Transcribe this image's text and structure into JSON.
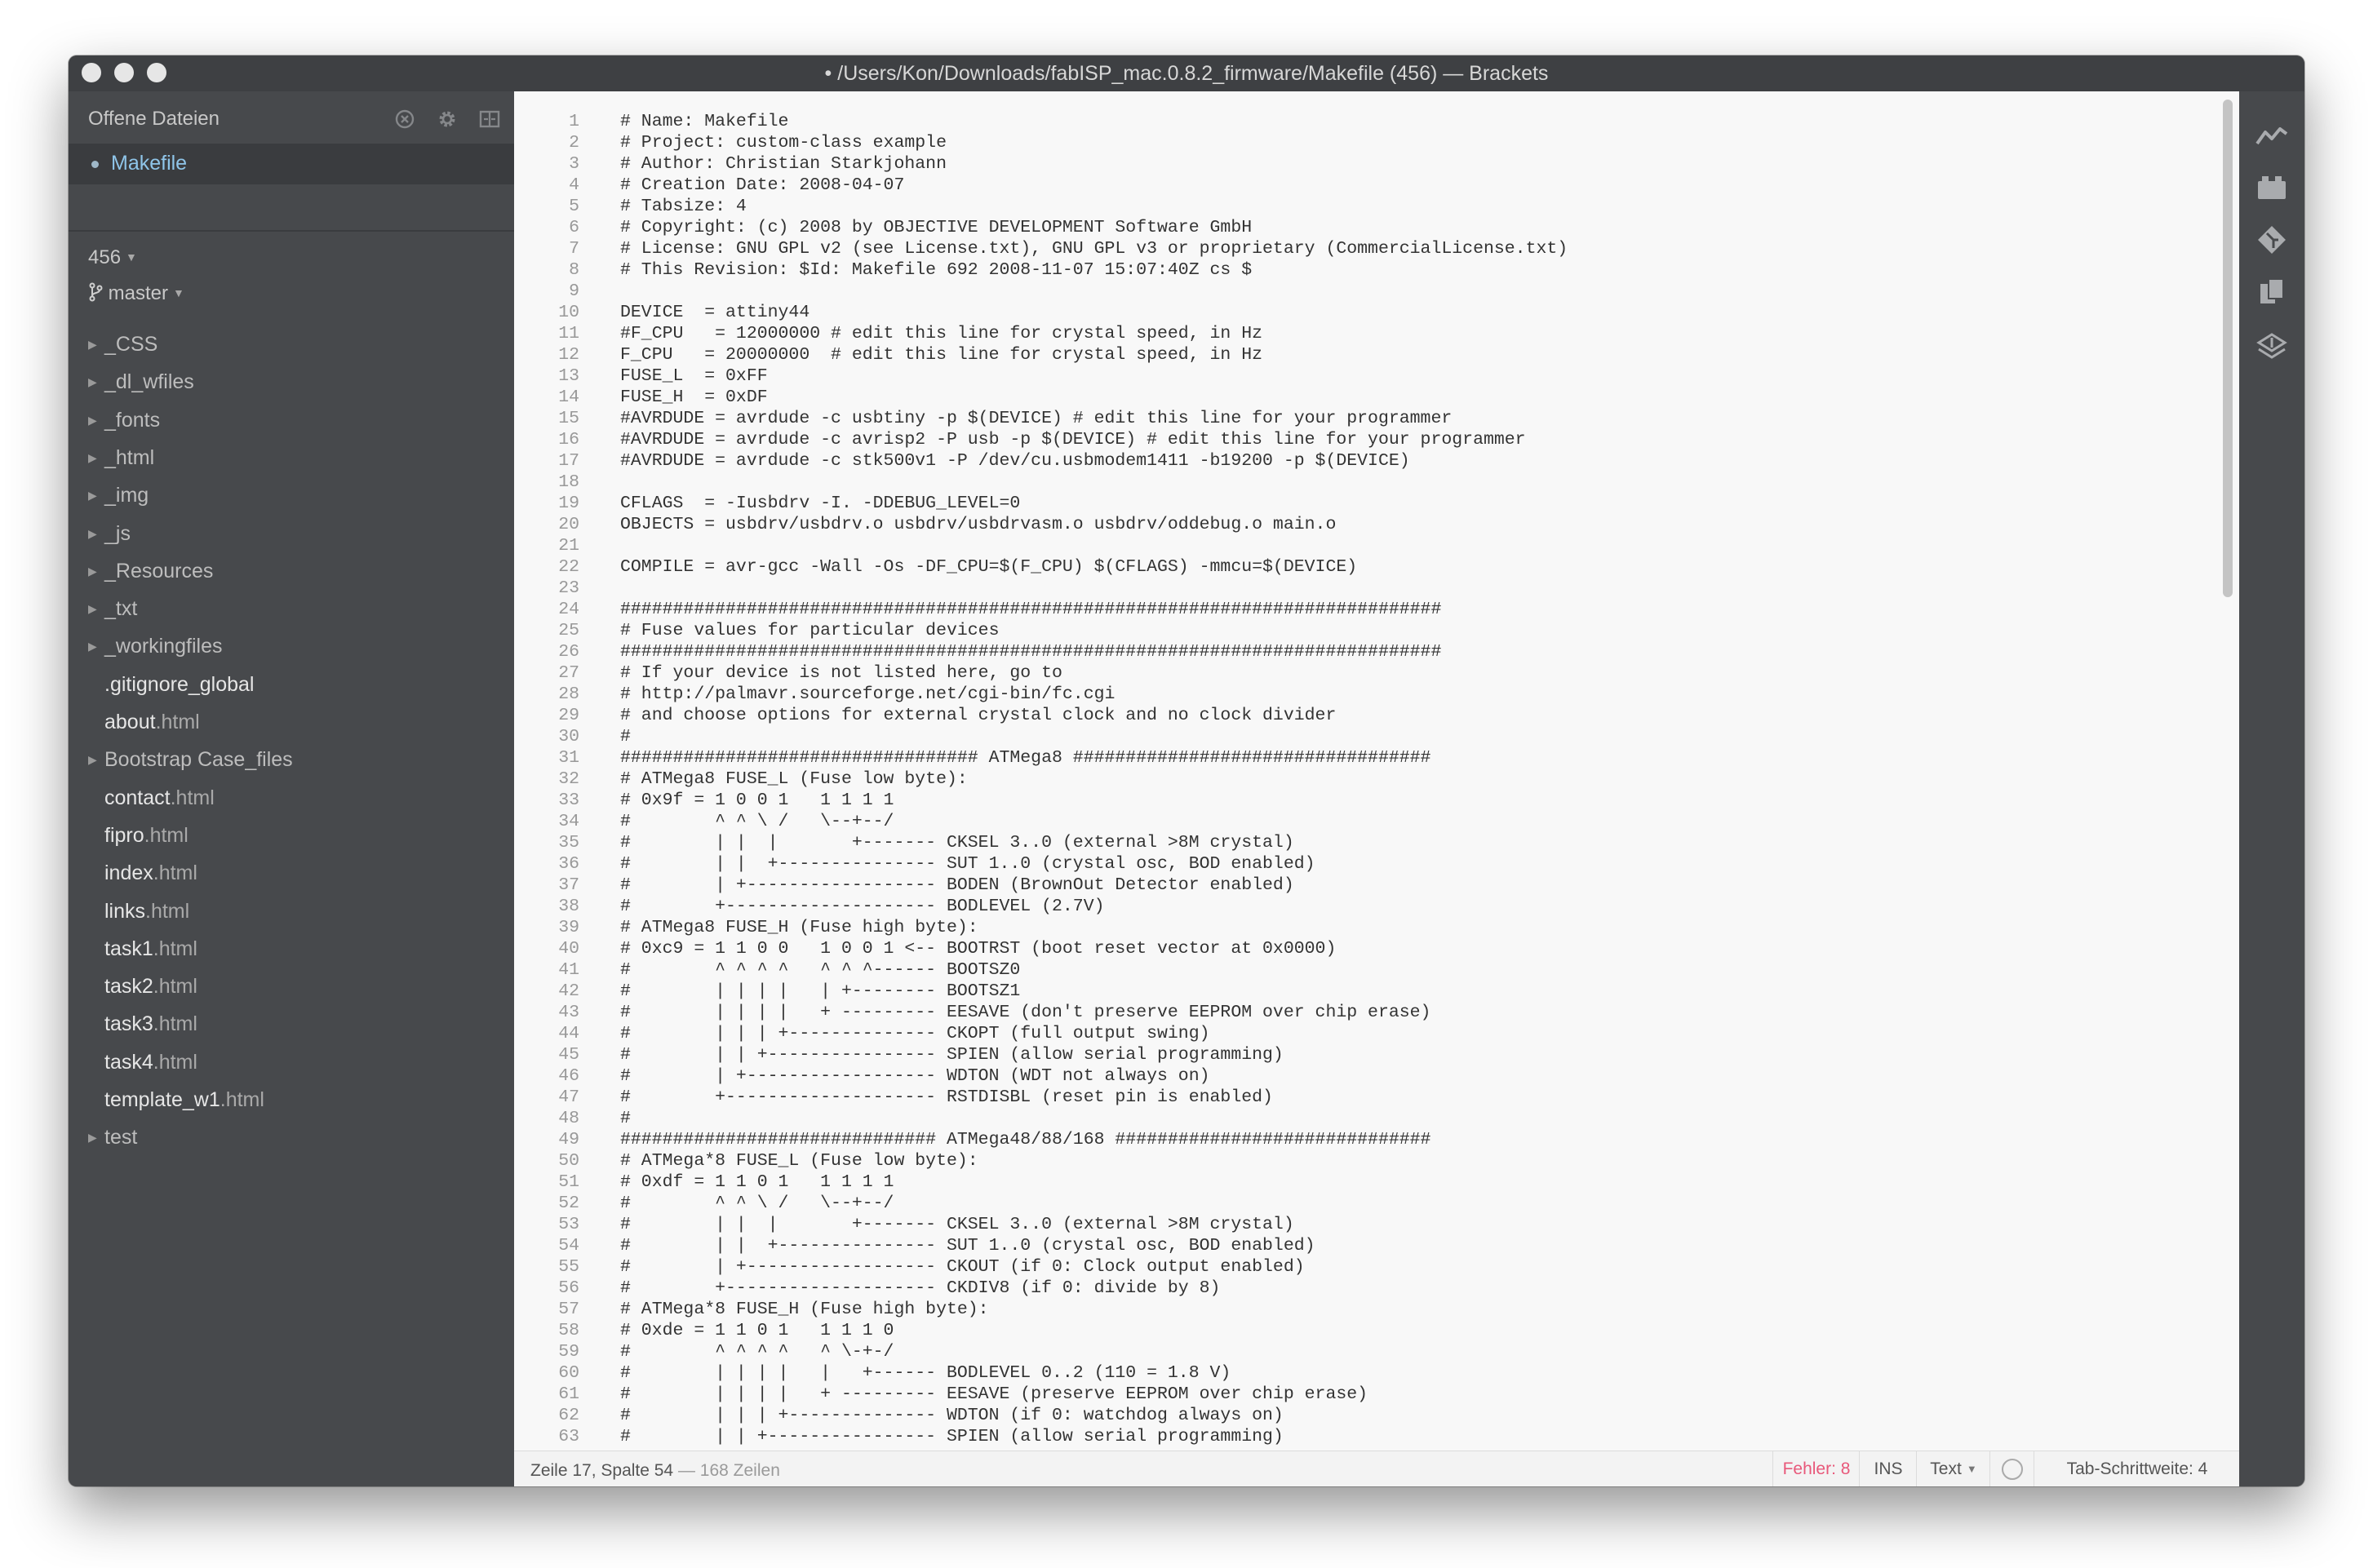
{
  "window": {
    "title": "• /Users/Kon/Downloads/fabISP_mac.0.8.2_firmware/Makefile (456) — Brackets"
  },
  "sidebar": {
    "header_label": "Offene Dateien",
    "working_files": [
      "Makefile"
    ],
    "project_name": "456",
    "branch": "master",
    "tree": [
      {
        "name": "_CSS",
        "type": "folder"
      },
      {
        "name": "_dl_wfiles",
        "type": "folder"
      },
      {
        "name": "_fonts",
        "type": "folder"
      },
      {
        "name": "_html",
        "type": "folder"
      },
      {
        "name": "_img",
        "type": "folder"
      },
      {
        "name": "_js",
        "type": "folder"
      },
      {
        "name": "_Resources",
        "type": "folder"
      },
      {
        "name": "_txt",
        "type": "folder"
      },
      {
        "name": "_workingfiles",
        "type": "folder"
      },
      {
        "name": ".gitignore_global",
        "type": "file",
        "base": ".gitignore_global",
        "ext": ""
      },
      {
        "name": "about.html",
        "type": "file",
        "base": "about",
        "ext": ".html"
      },
      {
        "name": "Bootstrap Case_files",
        "type": "folder"
      },
      {
        "name": "contact.html",
        "type": "file",
        "base": "contact",
        "ext": ".html"
      },
      {
        "name": "fipro.html",
        "type": "file",
        "base": "fipro",
        "ext": ".html"
      },
      {
        "name": "index.html",
        "type": "file",
        "base": "index",
        "ext": ".html"
      },
      {
        "name": "links.html",
        "type": "file",
        "base": "links",
        "ext": ".html"
      },
      {
        "name": "task1.html",
        "type": "file",
        "base": "task1",
        "ext": ".html"
      },
      {
        "name": "task2.html",
        "type": "file",
        "base": "task2",
        "ext": ".html"
      },
      {
        "name": "task3.html",
        "type": "file",
        "base": "task3",
        "ext": ".html"
      },
      {
        "name": "task4.html",
        "type": "file",
        "base": "task4",
        "ext": ".html"
      },
      {
        "name": "template_w1.html",
        "type": "file",
        "base": "template_w1",
        "ext": ".html"
      },
      {
        "name": "test",
        "type": "folder"
      }
    ]
  },
  "editor": {
    "lines": [
      {
        "n": "1",
        "t": "# Name: Makefile"
      },
      {
        "n": "2",
        "t": "# Project: custom-class example"
      },
      {
        "n": "3",
        "t": "# Author: Christian Starkjohann"
      },
      {
        "n": "4",
        "t": "# Creation Date: 2008-04-07"
      },
      {
        "n": "5",
        "t": "# Tabsize: 4"
      },
      {
        "n": "6",
        "t": "# Copyright: (c) 2008 by OBJECTIVE DEVELOPMENT Software GmbH"
      },
      {
        "n": "7",
        "t": "# License: GNU GPL v2 (see License.txt), GNU GPL v3 or proprietary (CommercialLicense.txt)"
      },
      {
        "n": "8",
        "t": "# This Revision: $Id: Makefile 692 2008-11-07 15:07:40Z cs $"
      },
      {
        "n": "9",
        "t": ""
      },
      {
        "n": "10",
        "t": "DEVICE  = attiny44"
      },
      {
        "n": "11",
        "t": "#F_CPU   = 12000000 # edit this line for crystal speed, in Hz"
      },
      {
        "n": "12",
        "t": "F_CPU   = 20000000  # edit this line for crystal speed, in Hz"
      },
      {
        "n": "13",
        "t": "FUSE_L  = 0xFF"
      },
      {
        "n": "14",
        "t": "FUSE_H  = 0xDF"
      },
      {
        "n": "15",
        "t": "#AVRDUDE = avrdude -c usbtiny -p $(DEVICE) # edit this line for your programmer"
      },
      {
        "n": "16",
        "t": "#AVRDUDE = avrdude -c avrisp2 -P usb -p $(DEVICE) # edit this line for your programmer"
      },
      {
        "n": "17",
        "t": "#AVRDUDE = avrdude -c stk500v1 -P /dev/cu.usbmodem1411 -b19200 -p $(DEVICE)"
      },
      {
        "n": "18",
        "t": ""
      },
      {
        "n": "19",
        "t": "CFLAGS  = -Iusbdrv -I. -DDEBUG_LEVEL=0"
      },
      {
        "n": "20",
        "t": "OBJECTS = usbdrv/usbdrv.o usbdrv/usbdrvasm.o usbdrv/oddebug.o main.o"
      },
      {
        "n": "21",
        "t": ""
      },
      {
        "n": "22",
        "t": "COMPILE = avr-gcc -Wall -Os -DF_CPU=$(F_CPU) $(CFLAGS) -mmcu=$(DEVICE)"
      },
      {
        "n": "23",
        "t": ""
      },
      {
        "n": "24",
        "t": "##############################################################################"
      },
      {
        "n": "25",
        "t": "# Fuse values for particular devices"
      },
      {
        "n": "26",
        "t": "##############################################################################"
      },
      {
        "n": "27",
        "t": "# If your device is not listed here, go to"
      },
      {
        "n": "28",
        "t": "# http://palmavr.sourceforge.net/cgi-bin/fc.cgi"
      },
      {
        "n": "29",
        "t": "# and choose options for external crystal clock and no clock divider"
      },
      {
        "n": "30",
        "t": "#"
      },
      {
        "n": "31",
        "t": "################################## ATMega8 ##################################"
      },
      {
        "n": "32",
        "t": "# ATMega8 FUSE_L (Fuse low byte):"
      },
      {
        "n": "33",
        "t": "# 0x9f = 1 0 0 1   1 1 1 1"
      },
      {
        "n": "34",
        "t": "#        ^ ^ \\ /   \\--+--/"
      },
      {
        "n": "35",
        "t": "#        | |  |       +------- CKSEL 3..0 (external >8M crystal)"
      },
      {
        "n": "36",
        "t": "#        | |  +--------------- SUT 1..0 (crystal osc, BOD enabled)"
      },
      {
        "n": "37",
        "t": "#        | +------------------ BODEN (BrownOut Detector enabled)"
      },
      {
        "n": "38",
        "t": "#        +-------------------- BODLEVEL (2.7V)"
      },
      {
        "n": "39",
        "t": "# ATMega8 FUSE_H (Fuse high byte):"
      },
      {
        "n": "40",
        "t": "# 0xc9 = 1 1 0 0   1 0 0 1 <-- BOOTRST (boot reset vector at 0x0000)"
      },
      {
        "n": "41",
        "t": "#        ^ ^ ^ ^   ^ ^ ^------ BOOTSZ0"
      },
      {
        "n": "42",
        "t": "#        | | | |   | +-------- BOOTSZ1"
      },
      {
        "n": "43",
        "t": "#        | | | |   + --------- EESAVE (don't preserve EEPROM over chip erase)"
      },
      {
        "n": "44",
        "t": "#        | | | +-------------- CKOPT (full output swing)"
      },
      {
        "n": "45",
        "t": "#        | | +---------------- SPIEN (allow serial programming)"
      },
      {
        "n": "46",
        "t": "#        | +------------------ WDTON (WDT not always on)"
      },
      {
        "n": "47",
        "t": "#        +-------------------- RSTDISBL (reset pin is enabled)"
      },
      {
        "n": "48",
        "t": "#"
      },
      {
        "n": "49",
        "t": "############################## ATMega48/88/168 ##############################"
      },
      {
        "n": "50",
        "t": "# ATMega*8 FUSE_L (Fuse low byte):"
      },
      {
        "n": "51",
        "t": "# 0xdf = 1 1 0 1   1 1 1 1"
      },
      {
        "n": "52",
        "t": "#        ^ ^ \\ /   \\--+--/"
      },
      {
        "n": "53",
        "t": "#        | |  |       +------- CKSEL 3..0 (external >8M crystal)"
      },
      {
        "n": "54",
        "t": "#        | |  +--------------- SUT 1..0 (crystal osc, BOD enabled)"
      },
      {
        "n": "55",
        "t": "#        | +------------------ CKOUT (if 0: Clock output enabled)"
      },
      {
        "n": "56",
        "t": "#        +-------------------- CKDIV8 (if 0: divide by 8)"
      },
      {
        "n": "57",
        "t": "# ATMega*8 FUSE_H (Fuse high byte):"
      },
      {
        "n": "58",
        "t": "# 0xde = 1 1 0 1   1 1 1 0"
      },
      {
        "n": "59",
        "t": "#        ^ ^ ^ ^   ^ \\-+-/"
      },
      {
        "n": "60",
        "t": "#        | | | |   |   +------ BODLEVEL 0..2 (110 = 1.8 V)"
      },
      {
        "n": "61",
        "t": "#        | | | |   + --------- EESAVE (preserve EEPROM over chip erase)"
      },
      {
        "n": "62",
        "t": "#        | | | +-------------- WDTON (if 0: watchdog always on)"
      },
      {
        "n": "63",
        "t": "#        | | +---------------- SPIEN (allow serial programming)"
      }
    ]
  },
  "statusbar": {
    "cursor": "Zeile 17, Spalte 54",
    "lines": "— 168 Zeilen",
    "errors": "Fehler: 8",
    "mode": "INS",
    "language": "Text",
    "tab_width": "Tab-Schrittweite:  4"
  },
  "right_toolbar": {
    "icons": [
      "live-preview-icon",
      "extension-manager-icon",
      "git-icon",
      "copy-files-icon",
      "layers-icon"
    ]
  },
  "colors": {
    "sidebar_bg": "#47494c",
    "editor_bg": "#f8f8f8",
    "active_file": "#8fc5e9",
    "error": "#e8587a"
  }
}
